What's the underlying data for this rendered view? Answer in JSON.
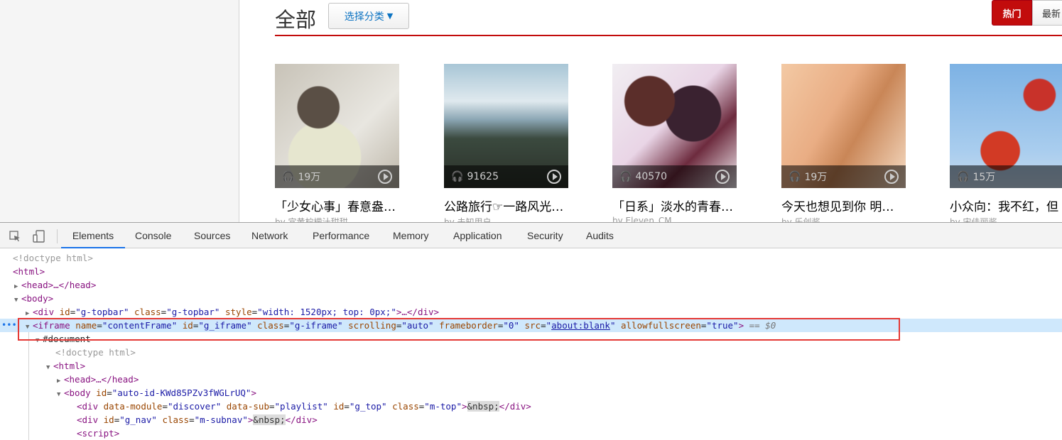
{
  "page": {
    "category_title": "全部",
    "category_button": "选择分类",
    "hot_button": "热门",
    "new_button": "最新",
    "playlists": [
      {
        "plays": "19万",
        "title": "「少女心事」春意盎…",
        "sub": "by 宜黄柠檬汁甜甜"
      },
      {
        "plays": "91625",
        "title": "公路旅行☞一路风光…",
        "sub": "by 未知用户"
      },
      {
        "plays": "40570",
        "title": "「日系」淡水的青春…",
        "sub": "by Eleven_CM"
      },
      {
        "plays": "19万",
        "title": "今天也想见到你 明…",
        "sub": "by 乐创酱"
      },
      {
        "plays": "15万",
        "title": "小众向：我不红，但",
        "sub": "by 宋佳丽酱"
      }
    ]
  },
  "devtools": {
    "tabs": [
      "Elements",
      "Console",
      "Sources",
      "Network",
      "Performance",
      "Memory",
      "Application",
      "Security",
      "Audits"
    ],
    "active_tab": "Elements",
    "lines": {
      "l1": "<!doctype html>",
      "l2_open": "<html>",
      "l3_head": "<head>…</head>",
      "l4_body": "<body>",
      "l5": {
        "tag_open": "<div",
        "id_name": "id",
        "id_val": "\"g-topbar\"",
        "class_name": "class",
        "class_val": "\"g-topbar\"",
        "style_name": "style",
        "style_val": "\"width: 1520px; top: 0px;\"",
        "tail": ">…</div>"
      },
      "l6": {
        "tag_open": "<iframe",
        "name_attr": "name",
        "name_val": "\"contentFrame\"",
        "id_attr": "id",
        "id_val": "\"g_iframe\"",
        "class_attr": "class",
        "class_val": "\"g-iframe\"",
        "scroll_attr": "scrolling",
        "scroll_val": "\"auto\"",
        "fb_attr": "frameborder",
        "fb_val": "\"0\"",
        "src_attr": "src",
        "src_val": "about:blank",
        "afs_attr": "allowfullscreen",
        "afs_val": "\"true\"",
        "close": ">",
        "dollar": "== $0"
      },
      "l7": "#document",
      "l8": "<!doctype html>",
      "l9": "<html>",
      "l10": "<head>…</head>",
      "l11": {
        "tag_open": "<body",
        "id_attr": "id",
        "id_val": "\"auto-id-KWd85PZv3fWGLrUQ\"",
        "close": ">"
      },
      "l12": {
        "tag_open": "<div",
        "dm_attr": "data-module",
        "dm_val": "\"discover\"",
        "ds_attr": "data-sub",
        "ds_val": "\"playlist\"",
        "id_attr": "id",
        "id_val": "\"g_top\"",
        "class_attr": "class",
        "class_val": "\"m-top\"",
        "close": ">",
        "nbsp": "&nbsp;",
        "end": "</div>"
      },
      "l13": {
        "tag_open": "<div",
        "id_attr": "id",
        "id_val": "\"g_nav\"",
        "class_attr": "class",
        "class_val": "\"m-subnav\"",
        "close": ">",
        "nbsp": "&nbsp;",
        "end": "</div>"
      },
      "l14": "<script>"
    }
  }
}
